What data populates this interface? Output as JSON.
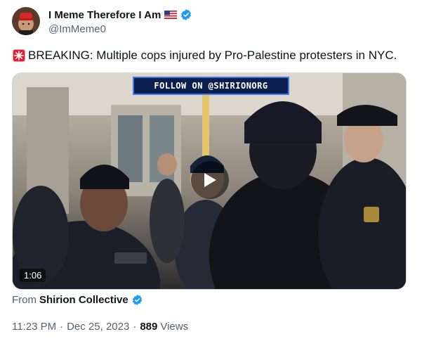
{
  "author": {
    "display_name": "I Meme Therefore I Am",
    "handle": "@ImMeme0",
    "flag_icon": "us-flag-icon",
    "verified_icon": "verified-badge-icon"
  },
  "tweet": {
    "text": "BREAKING: Multiple cops injured by Pro-Palestine protesters in NYC.",
    "leading_icon": "siren-icon"
  },
  "media": {
    "banner_text": "FOLLOW ON @SHIRIONORG",
    "duration": "1:06",
    "play_icon": "play-icon"
  },
  "source": {
    "prefix": "From",
    "name": "Shirion Collective"
  },
  "meta": {
    "time": "11:23 PM",
    "date": "Dec 25, 2023",
    "views_count": "889",
    "views_label": "Views"
  },
  "colors": {
    "verified": "#1d9bf0",
    "text": "#0f1419",
    "secondary": "#536471"
  }
}
